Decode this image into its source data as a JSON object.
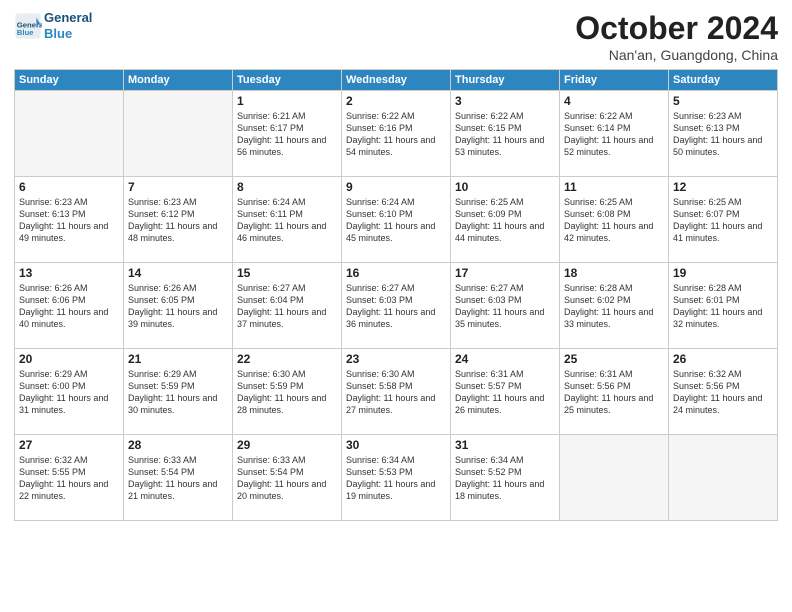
{
  "header": {
    "logo_line1": "General",
    "logo_line2": "Blue",
    "month": "October 2024",
    "location": "Nan'an, Guangdong, China"
  },
  "weekdays": [
    "Sunday",
    "Monday",
    "Tuesday",
    "Wednesday",
    "Thursday",
    "Friday",
    "Saturday"
  ],
  "weeks": [
    [
      {
        "day": "",
        "sunrise": "",
        "sunset": "",
        "daylight": "",
        "empty": true
      },
      {
        "day": "",
        "sunrise": "",
        "sunset": "",
        "daylight": "",
        "empty": true
      },
      {
        "day": "1",
        "sunrise": "Sunrise: 6:21 AM",
        "sunset": "Sunset: 6:17 PM",
        "daylight": "Daylight: 11 hours and 56 minutes."
      },
      {
        "day": "2",
        "sunrise": "Sunrise: 6:22 AM",
        "sunset": "Sunset: 6:16 PM",
        "daylight": "Daylight: 11 hours and 54 minutes."
      },
      {
        "day": "3",
        "sunrise": "Sunrise: 6:22 AM",
        "sunset": "Sunset: 6:15 PM",
        "daylight": "Daylight: 11 hours and 53 minutes."
      },
      {
        "day": "4",
        "sunrise": "Sunrise: 6:22 AM",
        "sunset": "Sunset: 6:14 PM",
        "daylight": "Daylight: 11 hours and 52 minutes."
      },
      {
        "day": "5",
        "sunrise": "Sunrise: 6:23 AM",
        "sunset": "Sunset: 6:13 PM",
        "daylight": "Daylight: 11 hours and 50 minutes."
      }
    ],
    [
      {
        "day": "6",
        "sunrise": "Sunrise: 6:23 AM",
        "sunset": "Sunset: 6:13 PM",
        "daylight": "Daylight: 11 hours and 49 minutes."
      },
      {
        "day": "7",
        "sunrise": "Sunrise: 6:23 AM",
        "sunset": "Sunset: 6:12 PM",
        "daylight": "Daylight: 11 hours and 48 minutes."
      },
      {
        "day": "8",
        "sunrise": "Sunrise: 6:24 AM",
        "sunset": "Sunset: 6:11 PM",
        "daylight": "Daylight: 11 hours and 46 minutes."
      },
      {
        "day": "9",
        "sunrise": "Sunrise: 6:24 AM",
        "sunset": "Sunset: 6:10 PM",
        "daylight": "Daylight: 11 hours and 45 minutes."
      },
      {
        "day": "10",
        "sunrise": "Sunrise: 6:25 AM",
        "sunset": "Sunset: 6:09 PM",
        "daylight": "Daylight: 11 hours and 44 minutes."
      },
      {
        "day": "11",
        "sunrise": "Sunrise: 6:25 AM",
        "sunset": "Sunset: 6:08 PM",
        "daylight": "Daylight: 11 hours and 42 minutes."
      },
      {
        "day": "12",
        "sunrise": "Sunrise: 6:25 AM",
        "sunset": "Sunset: 6:07 PM",
        "daylight": "Daylight: 11 hours and 41 minutes."
      }
    ],
    [
      {
        "day": "13",
        "sunrise": "Sunrise: 6:26 AM",
        "sunset": "Sunset: 6:06 PM",
        "daylight": "Daylight: 11 hours and 40 minutes."
      },
      {
        "day": "14",
        "sunrise": "Sunrise: 6:26 AM",
        "sunset": "Sunset: 6:05 PM",
        "daylight": "Daylight: 11 hours and 39 minutes."
      },
      {
        "day": "15",
        "sunrise": "Sunrise: 6:27 AM",
        "sunset": "Sunset: 6:04 PM",
        "daylight": "Daylight: 11 hours and 37 minutes."
      },
      {
        "day": "16",
        "sunrise": "Sunrise: 6:27 AM",
        "sunset": "Sunset: 6:03 PM",
        "daylight": "Daylight: 11 hours and 36 minutes."
      },
      {
        "day": "17",
        "sunrise": "Sunrise: 6:27 AM",
        "sunset": "Sunset: 6:03 PM",
        "daylight": "Daylight: 11 hours and 35 minutes."
      },
      {
        "day": "18",
        "sunrise": "Sunrise: 6:28 AM",
        "sunset": "Sunset: 6:02 PM",
        "daylight": "Daylight: 11 hours and 33 minutes."
      },
      {
        "day": "19",
        "sunrise": "Sunrise: 6:28 AM",
        "sunset": "Sunset: 6:01 PM",
        "daylight": "Daylight: 11 hours and 32 minutes."
      }
    ],
    [
      {
        "day": "20",
        "sunrise": "Sunrise: 6:29 AM",
        "sunset": "Sunset: 6:00 PM",
        "daylight": "Daylight: 11 hours and 31 minutes."
      },
      {
        "day": "21",
        "sunrise": "Sunrise: 6:29 AM",
        "sunset": "Sunset: 5:59 PM",
        "daylight": "Daylight: 11 hours and 30 minutes."
      },
      {
        "day": "22",
        "sunrise": "Sunrise: 6:30 AM",
        "sunset": "Sunset: 5:59 PM",
        "daylight": "Daylight: 11 hours and 28 minutes."
      },
      {
        "day": "23",
        "sunrise": "Sunrise: 6:30 AM",
        "sunset": "Sunset: 5:58 PM",
        "daylight": "Daylight: 11 hours and 27 minutes."
      },
      {
        "day": "24",
        "sunrise": "Sunrise: 6:31 AM",
        "sunset": "Sunset: 5:57 PM",
        "daylight": "Daylight: 11 hours and 26 minutes."
      },
      {
        "day": "25",
        "sunrise": "Sunrise: 6:31 AM",
        "sunset": "Sunset: 5:56 PM",
        "daylight": "Daylight: 11 hours and 25 minutes."
      },
      {
        "day": "26",
        "sunrise": "Sunrise: 6:32 AM",
        "sunset": "Sunset: 5:56 PM",
        "daylight": "Daylight: 11 hours and 24 minutes."
      }
    ],
    [
      {
        "day": "27",
        "sunrise": "Sunrise: 6:32 AM",
        "sunset": "Sunset: 5:55 PM",
        "daylight": "Daylight: 11 hours and 22 minutes."
      },
      {
        "day": "28",
        "sunrise": "Sunrise: 6:33 AM",
        "sunset": "Sunset: 5:54 PM",
        "daylight": "Daylight: 11 hours and 21 minutes."
      },
      {
        "day": "29",
        "sunrise": "Sunrise: 6:33 AM",
        "sunset": "Sunset: 5:54 PM",
        "daylight": "Daylight: 11 hours and 20 minutes."
      },
      {
        "day": "30",
        "sunrise": "Sunrise: 6:34 AM",
        "sunset": "Sunset: 5:53 PM",
        "daylight": "Daylight: 11 hours and 19 minutes."
      },
      {
        "day": "31",
        "sunrise": "Sunrise: 6:34 AM",
        "sunset": "Sunset: 5:52 PM",
        "daylight": "Daylight: 11 hours and 18 minutes."
      },
      {
        "day": "",
        "sunrise": "",
        "sunset": "",
        "daylight": "",
        "empty": true
      },
      {
        "day": "",
        "sunrise": "",
        "sunset": "",
        "daylight": "",
        "empty": true
      }
    ]
  ]
}
